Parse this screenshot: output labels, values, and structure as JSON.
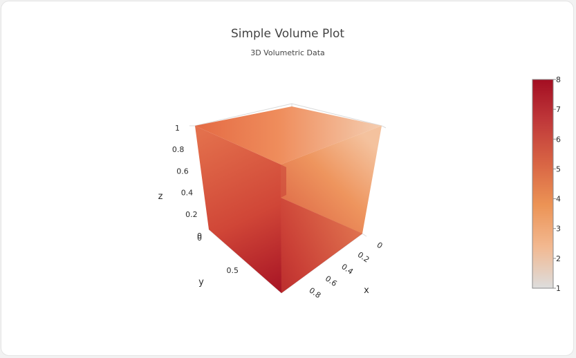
{
  "chart_data": {
    "type": "volume",
    "title": "Simple Volume Plot",
    "subtitle": "3D Volumetric Data",
    "axes": {
      "x": {
        "label": "x",
        "range": [
          0,
          1
        ],
        "ticks": [
          "0",
          "0.2",
          "0.4",
          "0.6",
          "0.8"
        ]
      },
      "y": {
        "label": "y",
        "range": [
          0,
          1
        ],
        "ticks": [
          "0",
          "0.5"
        ]
      },
      "z": {
        "label": "z",
        "range": [
          0,
          1
        ],
        "ticks": [
          "0",
          "0.2",
          "0.4",
          "0.6",
          "0.8",
          "1"
        ]
      }
    },
    "value_range": [
      1,
      8
    ],
    "colorbar": {
      "ticks": [
        "1",
        "2",
        "3",
        "4",
        "5",
        "6",
        "7",
        "8"
      ],
      "colorscale": [
        [
          0.0,
          "#dddddd"
        ],
        [
          0.2,
          "#f2b890"
        ],
        [
          0.4,
          "#ec9355"
        ],
        [
          0.6,
          "#d86444"
        ],
        [
          0.8,
          "#c0393a"
        ],
        [
          1.0,
          "#a30e22"
        ]
      ]
    },
    "grid": true,
    "legend": "none"
  }
}
